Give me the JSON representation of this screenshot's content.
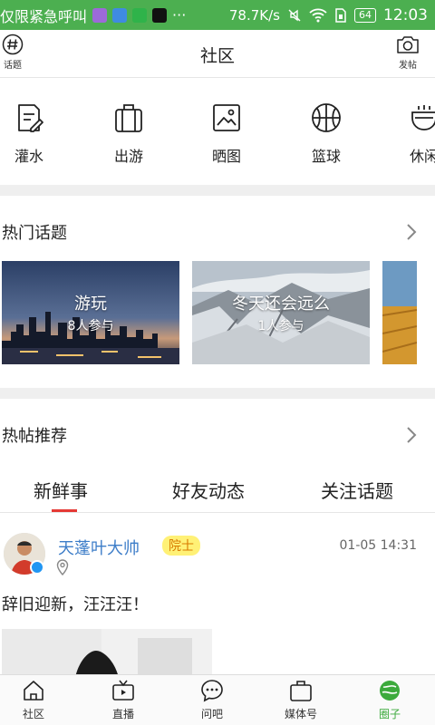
{
  "status_bar": {
    "notice": "仅限紧急呼叫",
    "dots": "···",
    "speed": "78.7K/s",
    "battery": "64",
    "time": "12:03"
  },
  "header": {
    "title": "社区",
    "left_label": "话题",
    "right_label": "发帖"
  },
  "categories": [
    {
      "label": "灌水",
      "icon": "note-edit-icon"
    },
    {
      "label": "出游",
      "icon": "luggage-icon"
    },
    {
      "label": "晒图",
      "icon": "picture-icon"
    },
    {
      "label": "篮球",
      "icon": "basketball-icon"
    },
    {
      "label": "休闲",
      "icon": "teacup-icon"
    }
  ],
  "hot_topics": {
    "title": "热门话题",
    "items": [
      {
        "name": "游玩",
        "count": "8人参与"
      },
      {
        "name": "冬天还会远么",
        "count": "1人参与"
      }
    ]
  },
  "recommended": {
    "title": "热帖推荐"
  },
  "tabs": {
    "items": [
      "新鲜事",
      "好友动态",
      "关注话题"
    ],
    "active": 0
  },
  "post": {
    "author": "天蓬叶大帅",
    "badge": "院士",
    "time": "01-05 14:31",
    "text": "辞旧迎新，汪汪汪！"
  },
  "bottom_nav": {
    "items": [
      "社区",
      "直播",
      "问吧",
      "媒体号",
      "圈子"
    ],
    "active": 4
  },
  "colors": {
    "status_bar": "#4caf50",
    "author_link": "#3d7dc8",
    "tab_indicator": "#e53935",
    "nav_active": "#3caa3c",
    "badge_bg": "#fff176"
  }
}
